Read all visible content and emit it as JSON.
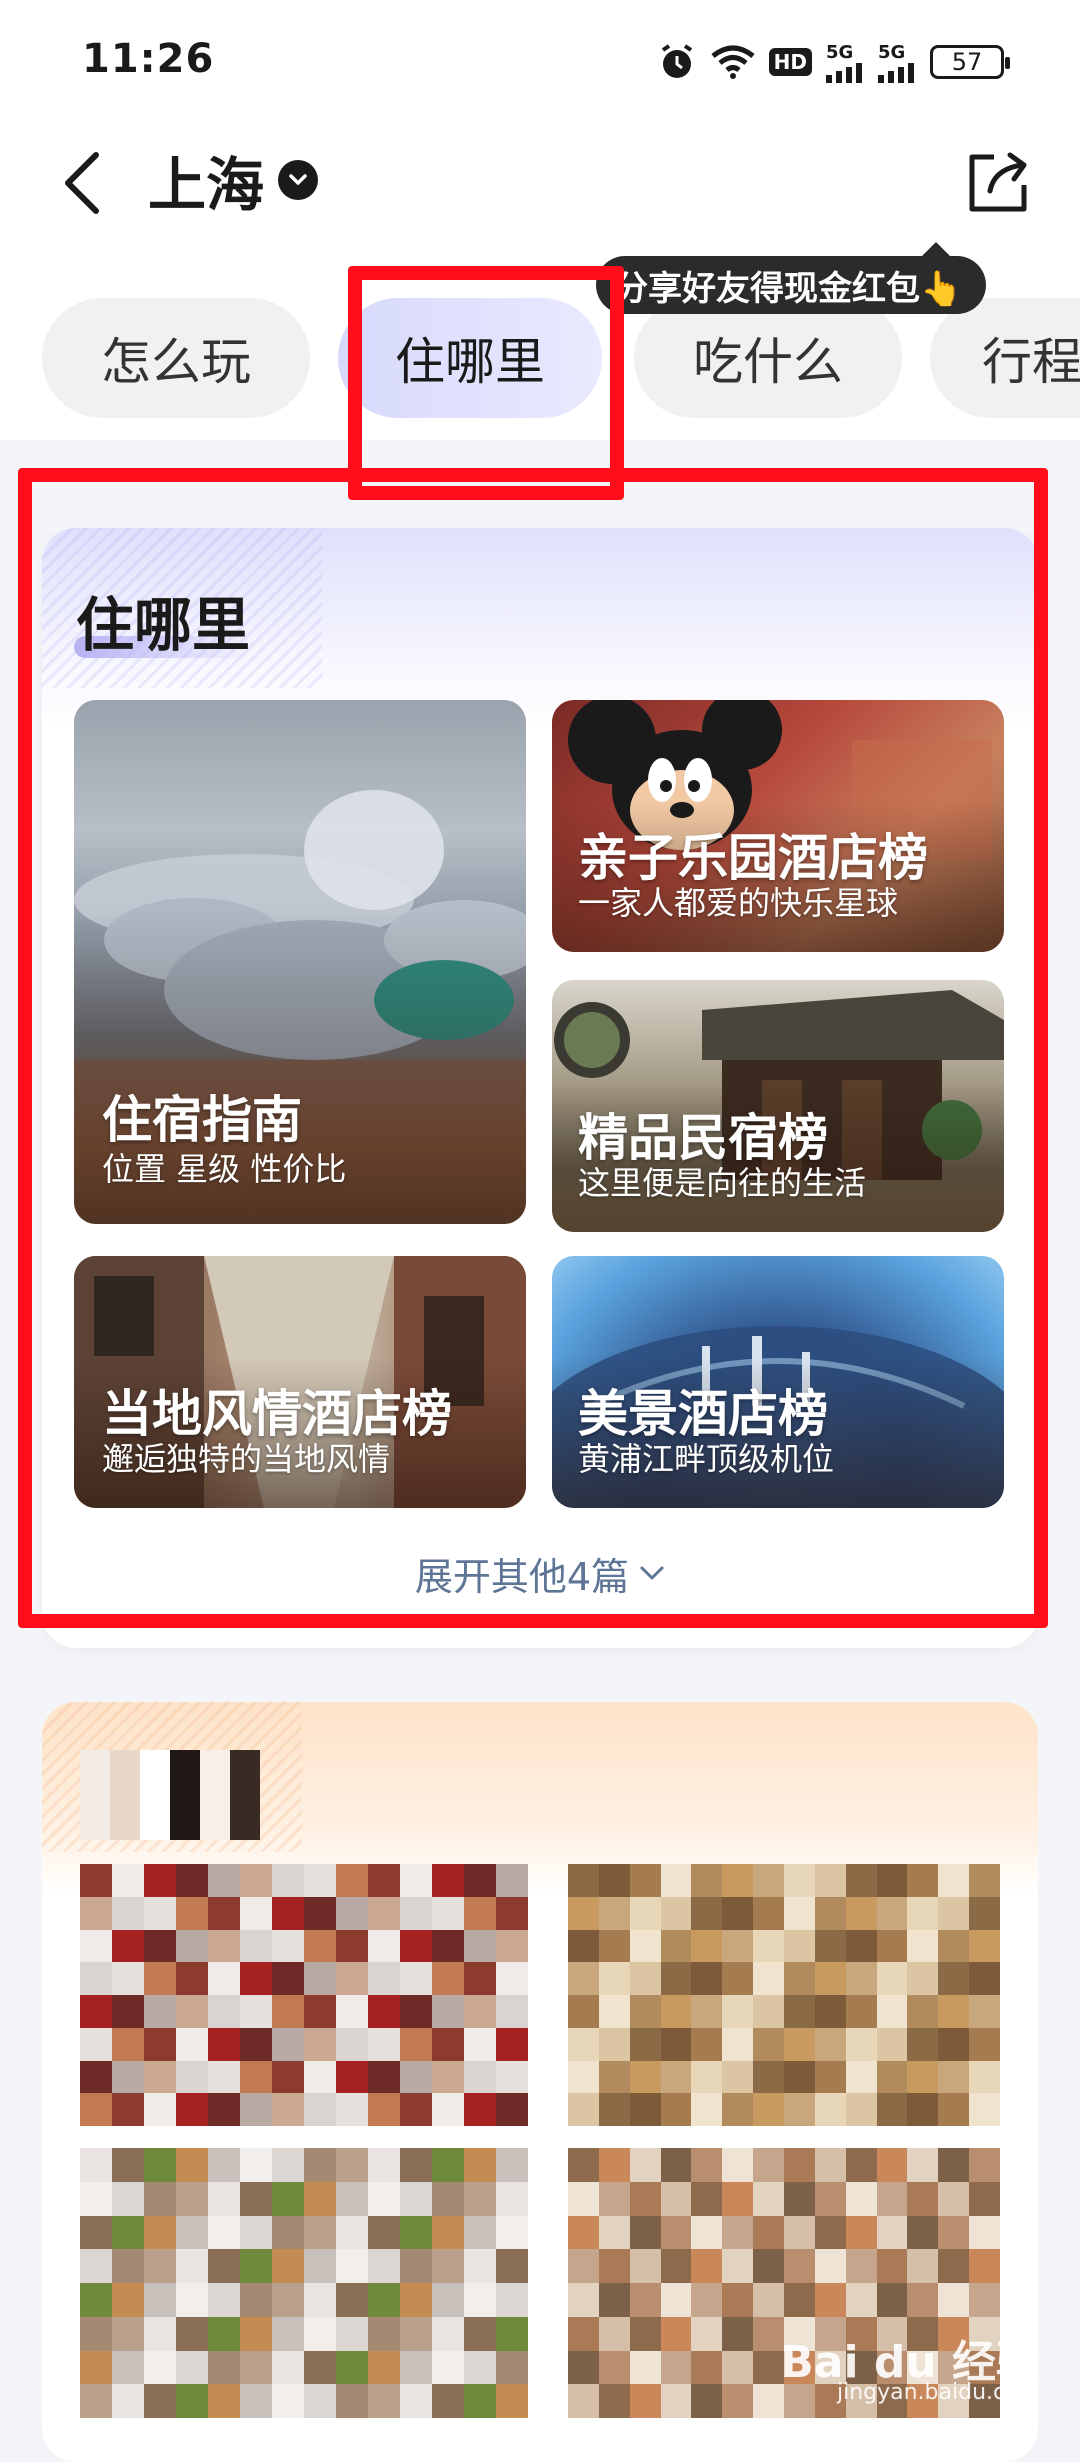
{
  "status_bar": {
    "time": "11:26",
    "hd_label": "HD",
    "net1": "5G",
    "net2": "5G",
    "battery": "57"
  },
  "nav": {
    "city": "上海",
    "share_tip": "分享好友得现金红包👆"
  },
  "tabs": [
    {
      "label": "怎么玩",
      "active": false
    },
    {
      "label": "住哪里",
      "active": true
    },
    {
      "label": "吃什么",
      "active": false
    },
    {
      "label": "行程",
      "active": false
    }
  ],
  "stay_section": {
    "title": "住哪里",
    "items": [
      {
        "title": "住宿指南",
        "subtitle": "位置 星级 性价比"
      },
      {
        "title": "亲子乐园酒店榜",
        "subtitle": "一家人都爱的快乐星球"
      },
      {
        "title": "精品民宿榜",
        "subtitle": "这里便是向往的生活"
      },
      {
        "title": "当地风情酒店榜",
        "subtitle": "邂逅独特的当地风情"
      },
      {
        "title": "美景酒店榜",
        "subtitle": "黄浦江畔顶级机位"
      }
    ],
    "expand_label": "展开其他4篇"
  },
  "watermark": {
    "logo": "Bai du 经验",
    "url": "jingyan.baidu.com"
  },
  "colors": {
    "highlight": "#ff0d1a",
    "active_tab": "#d7d9fb",
    "expand_link": "#5f7596"
  }
}
